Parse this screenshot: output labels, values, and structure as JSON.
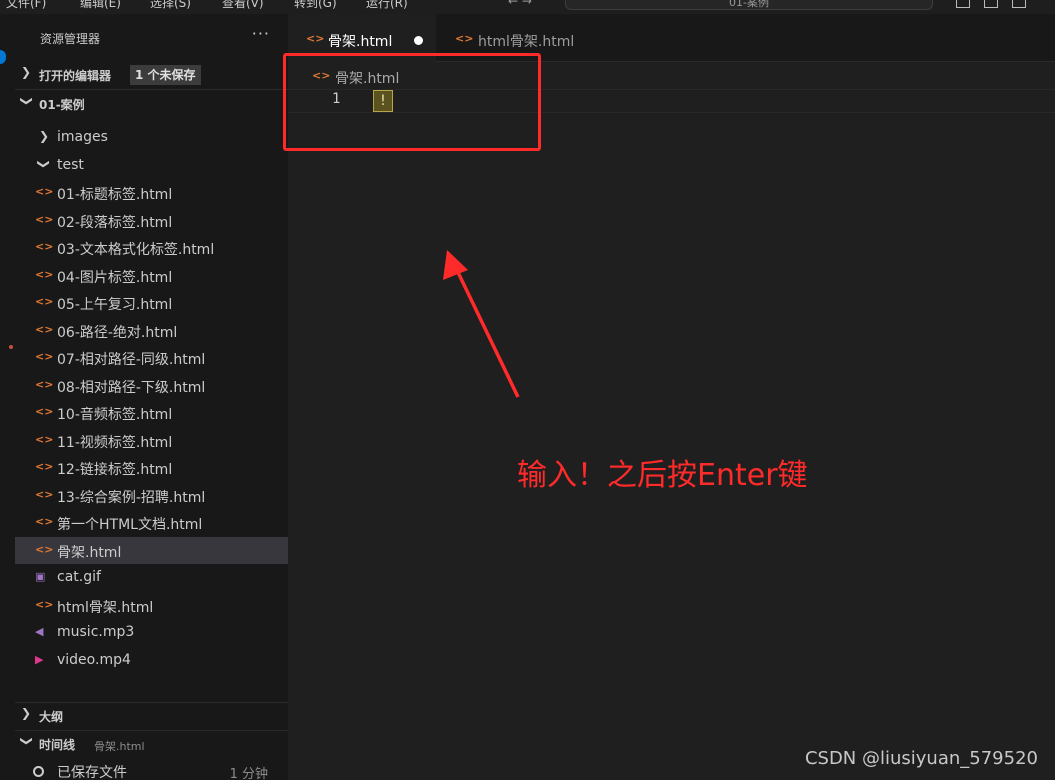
{
  "menubar": {
    "items": [
      "文件(F)",
      "编辑(E)",
      "选择(S)",
      "查看(V)",
      "转到(G)",
      "运行(R)"
    ],
    "command_center": "01-案例"
  },
  "sidebar": {
    "title": "资源管理器",
    "more": "···",
    "open_editors": {
      "label": "打开的编辑器",
      "badge": "1 个未保存"
    },
    "folder": {
      "label": "01-案例"
    },
    "tree": [
      {
        "name": "images",
        "kind": "folder",
        "expanded": false
      },
      {
        "name": "test",
        "kind": "folder",
        "expanded": true
      },
      {
        "name": "01-标题标签.html",
        "kind": "html"
      },
      {
        "name": "02-段落标签.html",
        "kind": "html"
      },
      {
        "name": "03-文本格式化标签.html",
        "kind": "html"
      },
      {
        "name": "04-图片标签.html",
        "kind": "html"
      },
      {
        "name": "05-上午复习.html",
        "kind": "html"
      },
      {
        "name": "06-路径-绝对.html",
        "kind": "html"
      },
      {
        "name": "07-相对路径-同级.html",
        "kind": "html"
      },
      {
        "name": "08-相对路径-下级.html",
        "kind": "html"
      },
      {
        "name": "10-音频标签.html",
        "kind": "html"
      },
      {
        "name": "11-视频标签.html",
        "kind": "html"
      },
      {
        "name": "12-链接标签.html",
        "kind": "html"
      },
      {
        "name": "13-综合案例-招聘.html",
        "kind": "html"
      },
      {
        "name": "第一个HTML文档.html",
        "kind": "html"
      },
      {
        "name": "骨架.html",
        "kind": "html",
        "selected": true
      },
      {
        "name": "cat.gif",
        "kind": "image"
      },
      {
        "name": "html骨架.html",
        "kind": "html"
      },
      {
        "name": "music.mp3",
        "kind": "audio"
      },
      {
        "name": "video.mp4",
        "kind": "video"
      }
    ],
    "outline": {
      "label": "大纲"
    },
    "timeline": {
      "label": "时间线",
      "file": "骨架.html",
      "entry": "已保存文件",
      "time": "1 分钟"
    }
  },
  "tabs": [
    {
      "label": "骨架.html",
      "active": true,
      "dirty": true
    },
    {
      "label": "html骨架.html",
      "active": false,
      "dirty": false
    }
  ],
  "editor": {
    "breadcrumb": "骨架.html",
    "line_number": "1",
    "content": "!"
  },
  "annotation": {
    "text": "输入！之后按Enter键",
    "color": "#ff2a2a"
  },
  "watermark": "CSDN @liusiyuan_579520",
  "colors": {
    "html_icon": "#e37933",
    "accent": "#0078d4",
    "selection": "#37373d"
  }
}
